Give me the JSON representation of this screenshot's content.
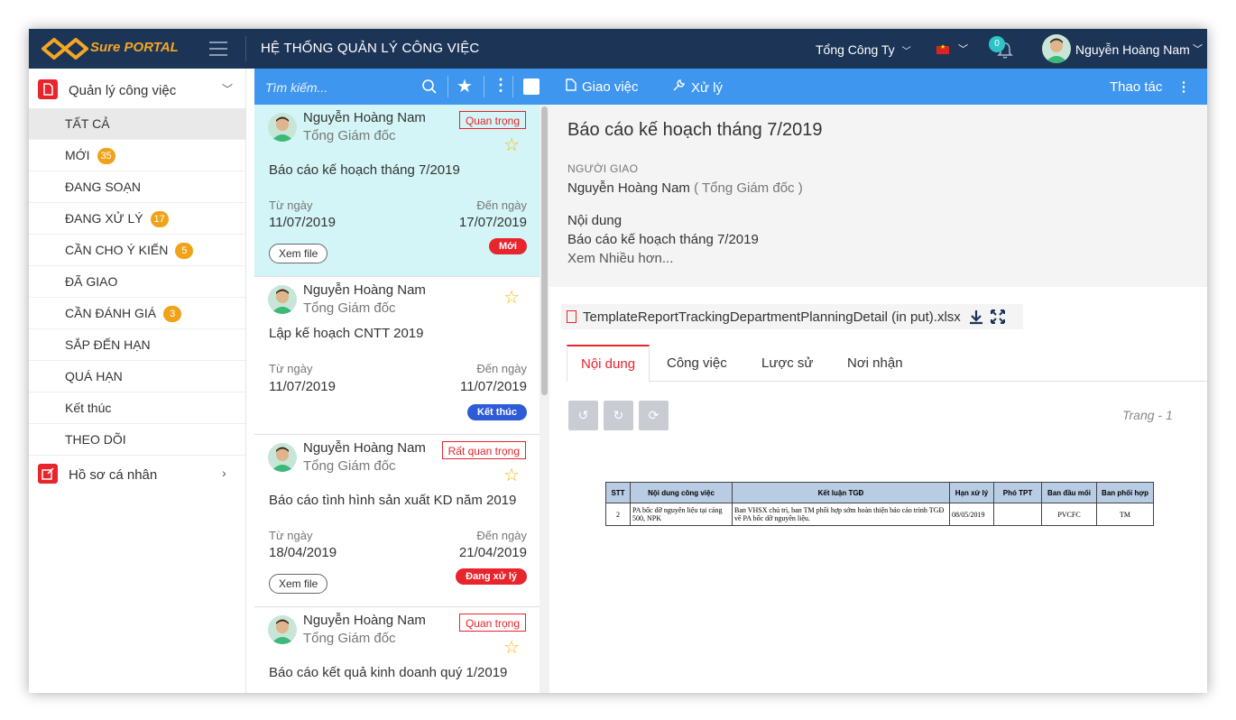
{
  "app": {
    "logo": {
      "sure": "Sure",
      "portal": "PORTAL"
    },
    "title": "HỆ THỐNG QUẢN LÝ CÔNG VIỆC",
    "company": "Tổng Công Ty",
    "notification_count": "0",
    "user_name": "Nguyễn Hoàng Nam"
  },
  "sidebar": {
    "section_label": "Quản lý công việc",
    "items": [
      {
        "label": "TẤT CẢ",
        "badge": ""
      },
      {
        "label": "MỚI",
        "badge": "35"
      },
      {
        "label": "ĐANG SOẠN",
        "badge": ""
      },
      {
        "label": "ĐANG XỬ LÝ",
        "badge": "17"
      },
      {
        "label": "CẦN CHO Ý KIẾN",
        "badge": "5"
      },
      {
        "label": "ĐÃ GIAO",
        "badge": ""
      },
      {
        "label": "CẦN ĐÁNH GIÁ",
        "badge": "3"
      },
      {
        "label": "SẮP ĐẾN HẠN",
        "badge": ""
      },
      {
        "label": "QUÁ HẠN",
        "badge": ""
      },
      {
        "label": "Kết thúc",
        "badge": ""
      },
      {
        "label": "THEO DÕI",
        "badge": ""
      }
    ],
    "profile_label": "Hồ sơ cá nhân"
  },
  "list": {
    "search_placeholder": "Tìm kiếm...",
    "from_label": "Từ ngày",
    "to_label": "Đến ngày",
    "view_file_label": "Xem file",
    "cards": [
      {
        "name": "Nguyễn Hoàng Nam",
        "position": "Tổng Giám đốc",
        "priority": "Quan trọng",
        "title": "Báo cáo kế hoạch tháng 7/2019",
        "from": "11/07/2019",
        "to": "17/07/2019",
        "status": "Mới",
        "status_color": "#e8242c",
        "has_file": true
      },
      {
        "name": "Nguyễn Hoàng Nam",
        "position": "Tổng Giám đốc",
        "priority": "",
        "title": "Lập kế hoạch CNTT 2019",
        "from": "11/07/2019",
        "to": "11/07/2019",
        "status": "Kết thúc",
        "status_color": "#2f5bd8",
        "has_file": false
      },
      {
        "name": "Nguyễn Hoàng Nam",
        "position": "Tổng Giám đốc",
        "priority": "Rất quan trọng",
        "title": "Báo cáo tình hình sản xuất KD năm 2019",
        "from": "18/04/2019",
        "to": "21/04/2019",
        "status": "Đang xử lý",
        "status_color": "#e8242c",
        "has_file": true
      },
      {
        "name": "Nguyễn Hoàng Nam",
        "position": "Tổng Giám đốc",
        "priority": "Quan trọng",
        "title": "Báo cáo kết quả kinh doanh quý 1/2019",
        "from": "",
        "to": "",
        "status": "",
        "status_color": "#e8242c",
        "has_file": false
      }
    ]
  },
  "detail": {
    "toolbar": {
      "assign_label": "Giao việc",
      "process_label": "Xử lý",
      "actions_label": "Thao tác"
    },
    "title": "Báo cáo kế hoạch tháng 7/2019",
    "giver_label": "NGƯỜI GIAO",
    "giver_name": "Nguyễn Hoàng Nam",
    "giver_position": "( Tổng Giám đốc )",
    "content_label": "Nội dung",
    "content_text": "Báo cáo kế hoạch tháng 7/2019",
    "more_label": "Xem Nhiều hơn...",
    "attachment": "TemplateReportTrackingDepartmentPlanningDetail (in put).xlsx",
    "tabs": [
      "Nội dung",
      "Công việc",
      "Lược sử",
      "Nơi nhận"
    ],
    "page_indicator": "Trang - 1",
    "sheet": {
      "headers": [
        "STT",
        "Nội dung công việc",
        "Kết luận TGĐ",
        "Hạn xử lý",
        "Phó TPT",
        "Ban đầu mối",
        "Ban phối hợp"
      ],
      "rows": [
        [
          "2",
          "PA bốc dỡ nguyên liệu tại cảng 500, NPK",
          "Ban VHSX chủ trì, ban TM phối hợp sớm hoàn thiện báo cáo trình TGĐ về PA bốc dỡ nguyên liệu.",
          "08/05/2019",
          "",
          "PVCFC",
          "TM"
        ]
      ]
    }
  },
  "colors": {
    "topbar": "#1c3557",
    "accent_blue": "#3f96ee",
    "accent_red": "#e8242c",
    "badge": "#f0a31a"
  }
}
